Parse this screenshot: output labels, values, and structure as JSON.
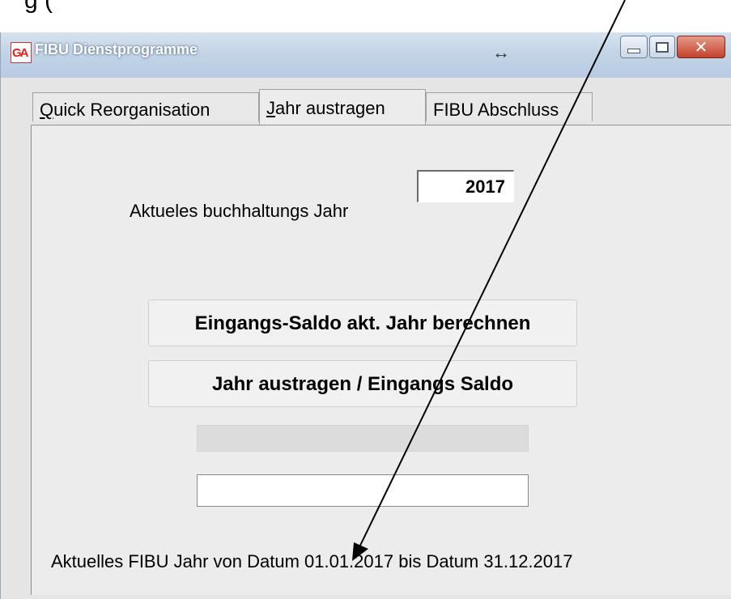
{
  "caption": "g                               (",
  "window": {
    "title": "FIBU Dienstprogramme",
    "icon": "ga-app-icon",
    "resize_glyph": "↔",
    "close_glyph": "✕"
  },
  "tabs": [
    {
      "mnemonic": "Q",
      "rest": "uick Reorganisation"
    },
    {
      "mnemonic": "J",
      "rest": "ahr austragen"
    },
    {
      "mnemonic": "",
      "rest": "FIBU Abschluss"
    }
  ],
  "main": {
    "year_label": "Aktueles buchhaltungs Jahr",
    "year_value": "2017",
    "button_calc": "Eingangs-Saldo akt. Jahr berechnen",
    "button_close_year": "Jahr austragen / Eingangs Saldo",
    "status": "Aktuelles FIBU Jahr von Datum 01.01.2017 bis Datum 31.12.2017"
  },
  "colors": {
    "titlebar": "#c2d3e6",
    "panel": "#ececec",
    "close_button": "#c2412b"
  }
}
